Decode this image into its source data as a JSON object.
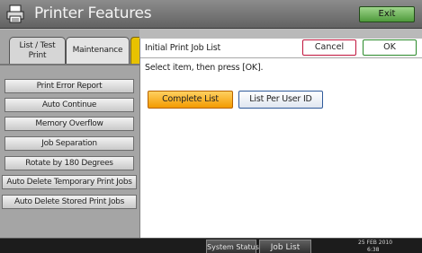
{
  "title_bar": {
    "app_icon": "printer-icon",
    "title": "Printer Features",
    "exit_label": "Exit"
  },
  "tabs": [
    {
      "label": "List / Test Print"
    },
    {
      "label": "Maintenance"
    }
  ],
  "menu_items": [
    "Print Error Report",
    "Auto Continue",
    "Memory Overflow",
    "Job Separation",
    "Rotate by 180 Degrees",
    "Auto Delete Temporary Print Jobs",
    "Auto Delete Stored Print Jobs"
  ],
  "dialog": {
    "title": "Initial Print Job List",
    "cancel_label": "Cancel",
    "ok_label": "OK",
    "instruction": "Select item, then press [OK].",
    "options": [
      {
        "label": "Complete List",
        "selected": true
      },
      {
        "label": "List Per User ID",
        "selected": false
      }
    ]
  },
  "status_bar": {
    "system_status_label": "System Status",
    "job_list_label": "Job List",
    "date": "25 FEB  2010",
    "time": "6:38"
  },
  "colors": {
    "selected_option": "#f5a300",
    "active_tab_accent": "#e8c200",
    "exit_button": "#5aa845",
    "cancel_border": "#c0143c",
    "ok_border": "#2a8a2a"
  }
}
